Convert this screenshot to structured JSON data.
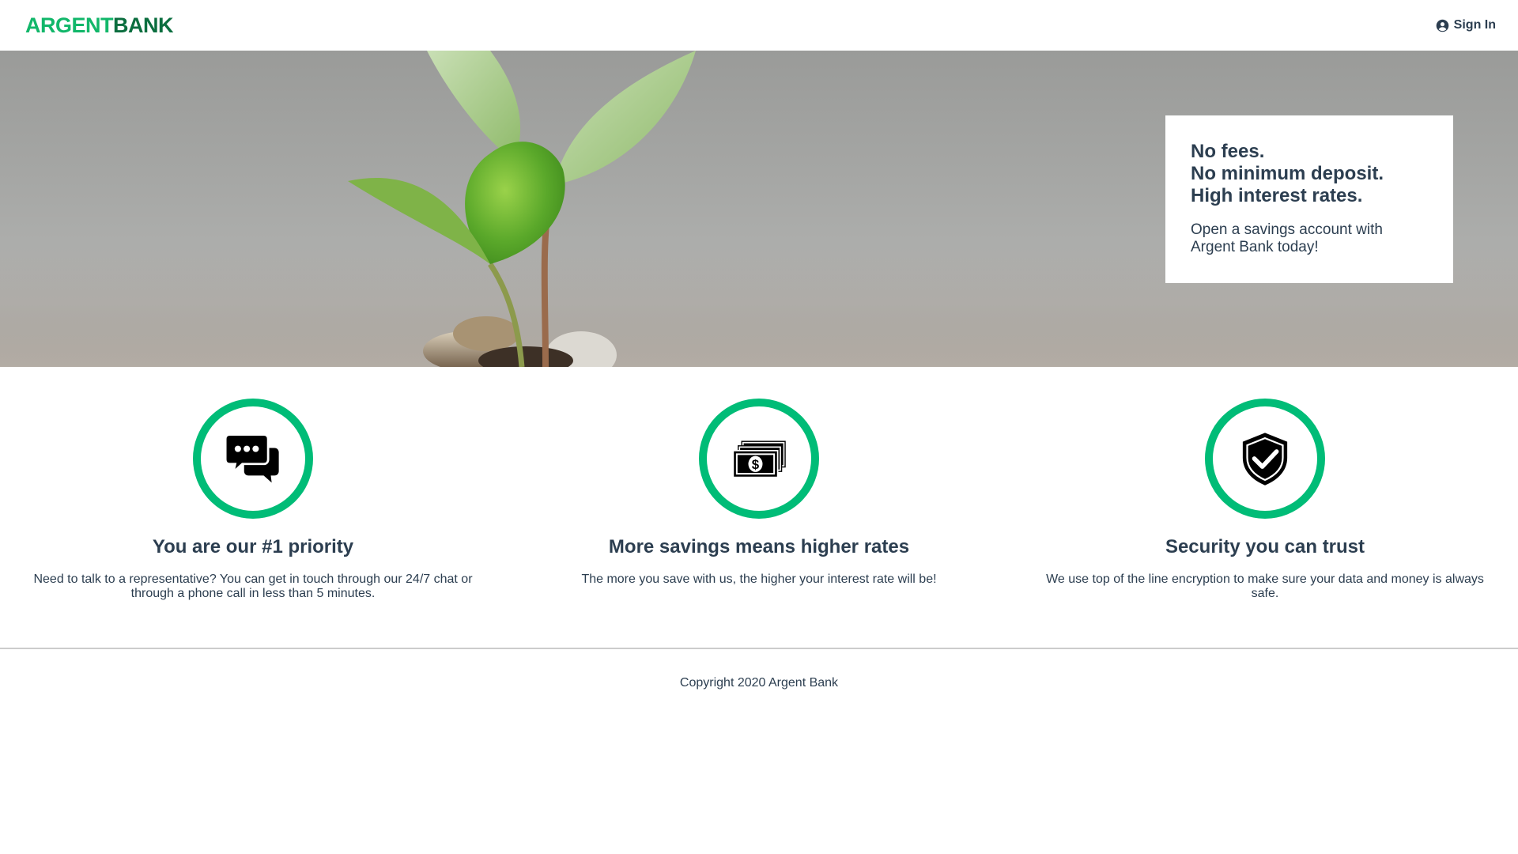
{
  "nav": {
    "logo_part1": "ARGENT",
    "logo_part2": "BANK",
    "sign_in_label": "Sign In",
    "sign_in_icon": "user-circle-icon"
  },
  "hero": {
    "subtitles": [
      "No fees.",
      "No minimum deposit.",
      "High interest rates."
    ],
    "text": "Open a savings account with Argent Bank today!"
  },
  "features": [
    {
      "icon": "chat-icon",
      "title": "You are our #1 priority",
      "text": "Need to talk to a representative? You can get in touch through our 24/7 chat or through a phone call in less than 5 minutes."
    },
    {
      "icon": "money-icon",
      "title": "More savings means higher rates",
      "text": "The more you save with us, the higher your interest rate will be!"
    },
    {
      "icon": "security-shield-icon",
      "title": "Security you can trust",
      "text": "We use top of the line encryption to make sure your data and money is always safe."
    }
  ],
  "footer": {
    "copyright": "Copyright 2020 Argent Bank"
  },
  "colors": {
    "accent": "#00bc77",
    "text": "#2c3e50",
    "logo_dark": "#0b6e3f"
  }
}
